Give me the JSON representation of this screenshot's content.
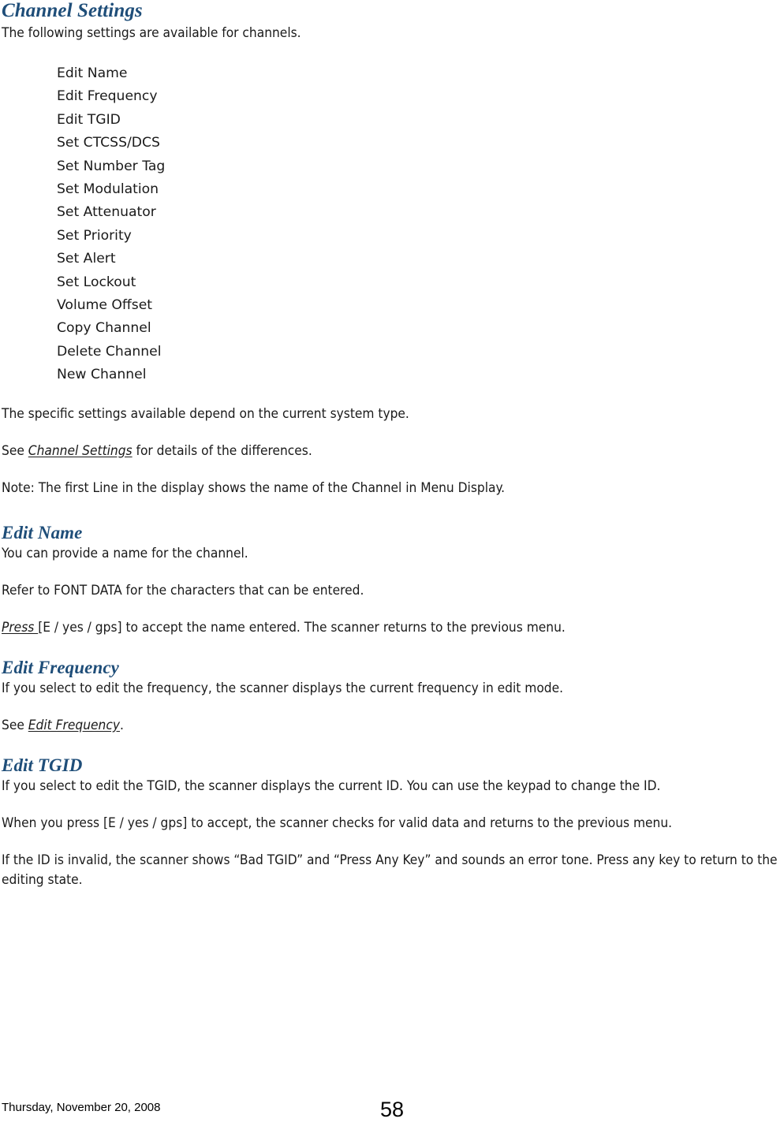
{
  "document": {
    "title": "Channel Settings"
  },
  "sections": {
    "channel_settings": {
      "heading": "Channel Settings",
      "intro": "The following settings are available for channels.",
      "settings_list": [
        "Edit Name",
        "Edit Frequency",
        "Edit TGID",
        "Set CTCSS/DCS",
        "Set Number Tag",
        "Set Modulation",
        "Set Attenuator",
        "Set Priority",
        "Set Alert",
        "Set Lockout",
        "Volume Offset",
        "Copy Channel",
        "Delete Channel",
        "New Channel"
      ],
      "para_depends": "The specific settings available depend on the current system type.",
      "see_prefix": "See ",
      "see_link": "Channel Settings",
      "see_suffix": " for details of the differences.",
      "note": "Note: The first Line in the display shows the name of the Channel in Menu Display."
    },
    "edit_name": {
      "heading": "Edit Name",
      "para_provide": "You can provide a name for the channel.",
      "para_refer": "Refer to FONT DATA for the characters that can be entered.",
      "press_link": "Press ",
      "press_rest": "[E / yes / gps] to accept the name entered. The scanner returns to the previous menu."
    },
    "edit_frequency": {
      "heading": "Edit Frequency",
      "para_select": "If you select to edit the frequency, the scanner displays the current frequency in edit mode.",
      "see_prefix": "See ",
      "see_link": "Edit Frequency",
      "see_suffix": "."
    },
    "edit_tgid": {
      "heading": "Edit TGID",
      "para_select": "If you select to edit the TGID, the scanner displays the current ID. You can use the keypad to change the ID.",
      "para_accept": "When you press [E / yes / gps] to accept, the scanner checks for valid data and returns to the previous menu.",
      "para_invalid": "If the ID is invalid, the scanner shows “Bad TGID” and “Press Any Key” and sounds an error tone. Press any key to return to the editing state."
    }
  },
  "footer": {
    "date": "Thursday, November 20, 2008",
    "page_number": "58"
  },
  "colors": {
    "heading": "#1F4E79",
    "body_text": "#1a1a1a",
    "page_background": "#ffffff"
  }
}
